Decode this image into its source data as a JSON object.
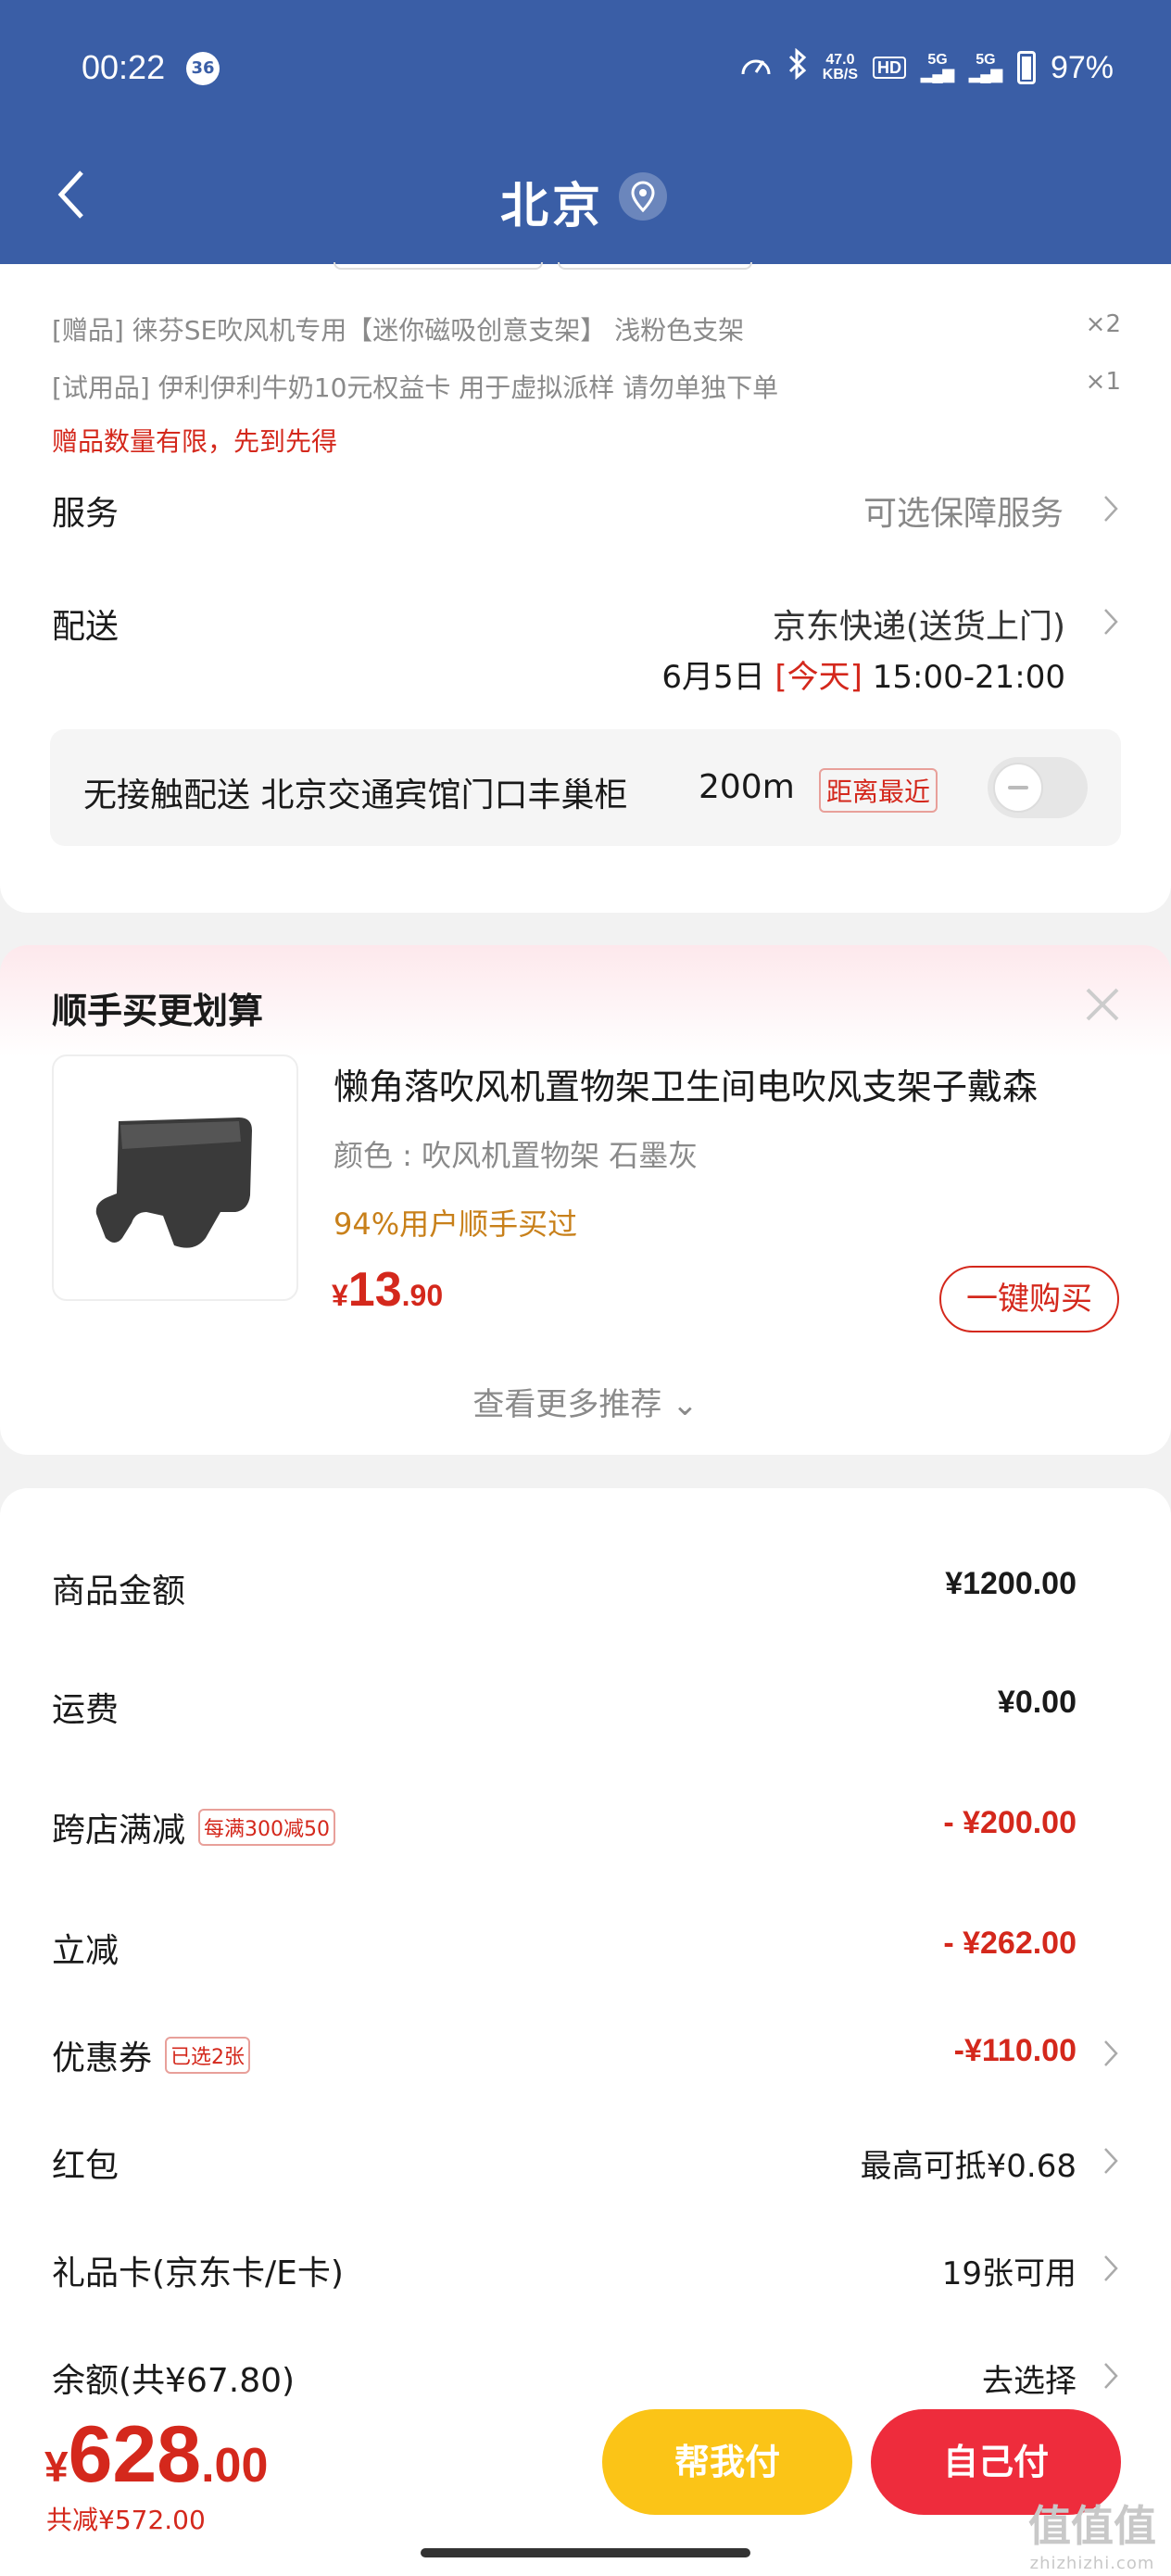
{
  "status_bar": {
    "time": "00:22",
    "notif_count": "36",
    "net_speed_value": "47.0",
    "net_speed_unit": "KB/S",
    "hd_label": "HD",
    "signal1": "5G",
    "signal2": "5G",
    "battery": "97%"
  },
  "nav": {
    "title": "北京"
  },
  "gifts": [
    {
      "text": "[赠品]  徕芬SE吹风机专用【迷你磁吸创意支架】 浅粉色支架",
      "qty": "×2"
    },
    {
      "text": "[试用品]  伊利伊利牛奶10元权益卡 用于虚拟派样 请勿单独下单",
      "qty": "×1"
    }
  ],
  "gift_note": "赠品数量有限，先到先得",
  "service": {
    "label": "服务",
    "value": "可选保障服务"
  },
  "delivery": {
    "label": "配送",
    "method": "京东快递(送货上门)",
    "date": "6月5日 ",
    "today": "[今天]",
    "slot": " 15:00-21:00"
  },
  "contactless": {
    "text": "无接触配送    北京交通宾馆门口丰巢柜",
    "distance": "200m",
    "tag": "距离最近"
  },
  "recommend": {
    "title": "顺手买更划算",
    "product_name": "懒角落吹风机置物架卫生间电吹风支架子戴森",
    "color": "颜色 : 吹风机置物架 石墨灰",
    "bought": "94%用户顺手买过",
    "price_symbol": "¥",
    "price_int": "13",
    "price_dec": ".90",
    "buy_label": "一键购买",
    "more_label": "查看更多推荐 ⌄"
  },
  "summary": {
    "items_label": "商品金额",
    "items_value": "¥1200.00",
    "shipping_label": "运费",
    "shipping_value": "¥0.00",
    "cross_label": "跨店满减",
    "cross_tag": "每满300减50",
    "cross_value": "- ¥200.00",
    "instant_label": "立减",
    "instant_value": "- ¥262.00",
    "coupon_label": "优惠券",
    "coupon_tag": "已选2张",
    "coupon_value": "-¥110.00",
    "redpack_label": "红包",
    "redpack_value": "最高可抵¥0.68",
    "giftcard_label": "礼品卡(京东卡/E卡)",
    "giftcard_value": "19张可用",
    "balance_label": "余额(共¥67.80)",
    "balance_value": "去选择"
  },
  "footer": {
    "price_symbol": "¥",
    "price_int": "628",
    "price_dec": ".00",
    "saved": "共减¥572.00",
    "help_label": "帮我付",
    "self_label": "自己付",
    "watermark": "值值值",
    "watermark_sub": "zhizhizhi.com"
  },
  "colors": {
    "header_bg": "#3a5ea6",
    "accent_red": "#d4281c",
    "help_btn": "#fbc417",
    "self_btn": "#ee2c3c",
    "bought_orange": "#c8801a"
  }
}
